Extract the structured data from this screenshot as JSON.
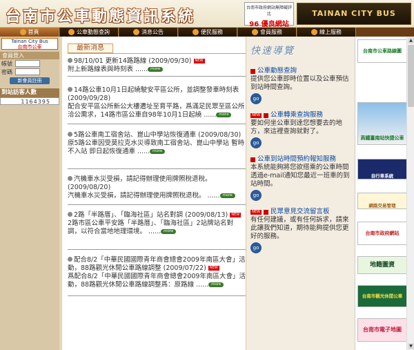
{
  "header": {
    "site_title": "台南市公車動態資訊系統",
    "award_small": "台南市政府網站無障礙評比",
    "award_big": "96 優良網站",
    "banner": "TAINAN CITY BUS"
  },
  "nav": [
    "首頁",
    "公車動態查詢",
    "消息公告",
    "便民服務",
    "會員服務",
    "線上服務"
  ],
  "left": {
    "logo_en": "Tainan City Bus",
    "logo_zh": "台南市公車",
    "member_login": "會員登入",
    "account_label": "帳號",
    "password_label": "密碼",
    "join_button": "新會員註冊",
    "visitor_label": "到站訪客人數",
    "visitor_count": "1164395"
  },
  "main": {
    "tab": "最新消息",
    "more": "more",
    "new": "NEW",
    "news": [
      {
        "line1": "98/10/01 更新14路路線 (2009/09/30)",
        "body": "附上新路線表與時刻表 ......",
        "has_new": true
      },
      {
        "line1": "14路公車10月1日起繞駛安平區公所，並調整發車時刻表 (2009/09/28)",
        "body": "配合安平區公所新公大樓遷址至育平路，爲滿足民眾至區公所洽公需求，14路市區公車自98年10月1日起繞 ......",
        "has_new": false
      },
      {
        "line1": "5路公車南工宿舍站、崑山中學站恢復通車 (2009/08/30)",
        "body": "原5路公車因受莫拉克水災導致南工宿舍站、崑山中學站 暫時不入站 即日起恢復通車 ......",
        "has_new": false
      },
      {
        "line1": "汽機車水災受損，請記得辦理使用牌照稅退稅。 (2009/08/20)",
        "body": "汽機車水災受損，請記得辦理使用牌照稅退稅。 ......",
        "has_new": false
      },
      {
        "line1": "2路「半路厝」、「臨海社區」站名對調 (2009/08/13)",
        "body": "2路市區公車平安路「半路厝」、「臨海社區」2站牌站名對調，以符合當地地理環境。 ......",
        "has_new": true
      },
      {
        "line1": "配合8/2「中華民國國際青年商會總會2009年南區大會」活動，88路觀光休閒公車路線調整 (2009/07/22)",
        "body": "爲配合8/2「中華民國國際青年商會總會2009年南區大會」活動，88路觀光休閒公車路線調整爲：原路線 ......",
        "has_new": true
      }
    ]
  },
  "right": {
    "quick_head": "快速導覽",
    "go": "go",
    "services": [
      {
        "title": "公車動態查詢",
        "desc": "提供您公車即時位置以及公車預估到站時間查詢。",
        "has_new": false
      },
      {
        "title": "公車轉乘查詢服務",
        "desc": "要如何坐公車到達您想要去的地方，來這裡查詢就對了。",
        "has_new": true
      },
      {
        "title": "公車到站時間預約報知服務",
        "desc": "本系統能夠將您欲搭乘的公車時間透過e-mail通知您最近一班車的到站時間。",
        "has_new": false
      },
      {
        "title": "民眾意見交流留言板",
        "desc": "有任何建議，或有任何訴求，請來此讓我們知道，期待能夠提供您更好的服務。",
        "has_new": true
      }
    ]
  },
  "sidebar": [
    "台南市公車路線圖",
    "高鐵臺南站快捷公車",
    "自行車系統",
    "網路交易管理",
    "台南市政府網站",
    "地籍圖資",
    "台南市觀光休閒公車",
    "台南市電子地圖"
  ]
}
